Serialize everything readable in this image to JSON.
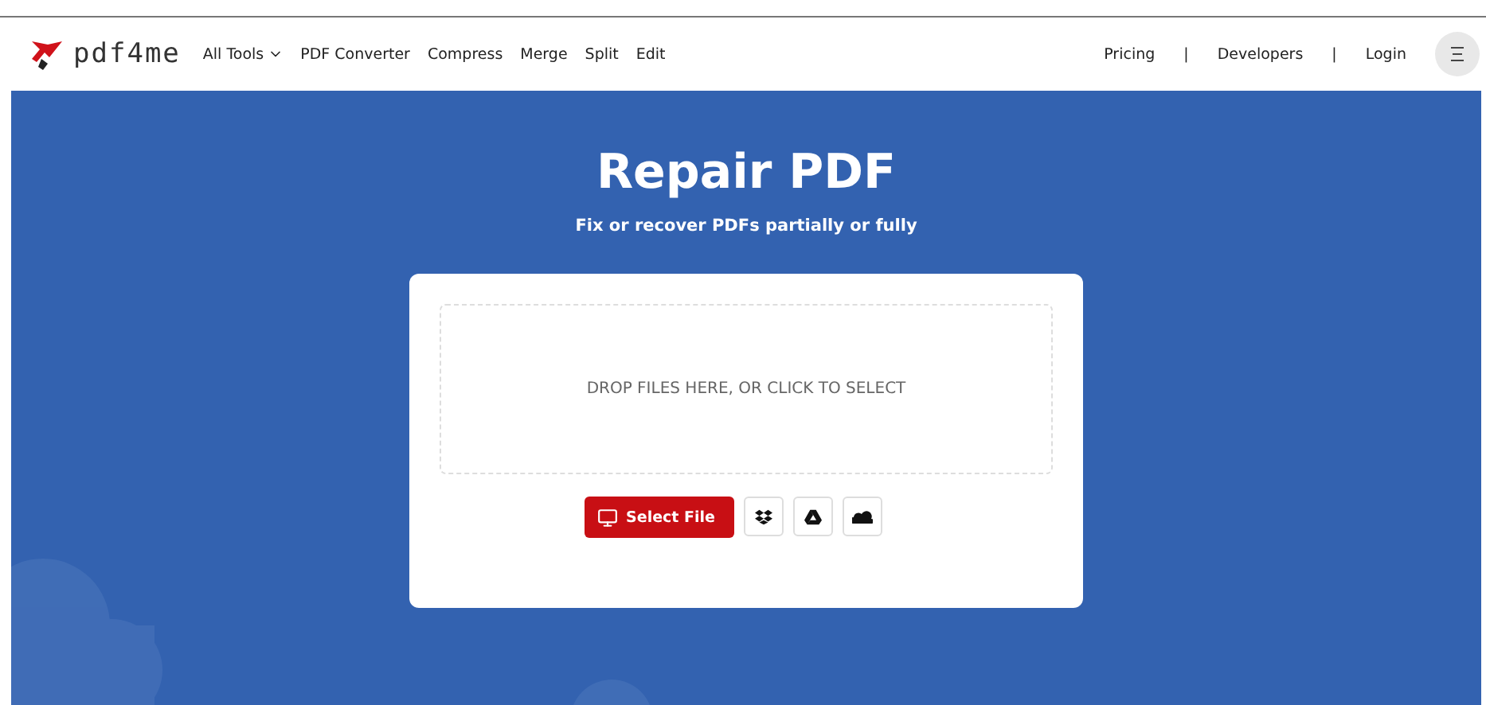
{
  "header": {
    "brand": "pdf4me",
    "nav": [
      {
        "label": "All Tools",
        "dropdown": true
      },
      {
        "label": "PDF Converter",
        "dropdown": false
      },
      {
        "label": "Compress",
        "dropdown": false
      },
      {
        "label": "Merge",
        "dropdown": false
      },
      {
        "label": "Split",
        "dropdown": false
      },
      {
        "label": "Edit",
        "dropdown": false
      }
    ],
    "right_links": [
      {
        "label": "Pricing"
      },
      {
        "label": "|"
      },
      {
        "label": "Developers"
      },
      {
        "label": "|"
      },
      {
        "label": "Login"
      }
    ]
  },
  "hero": {
    "title": "Repair PDF",
    "subtitle": "Fix or recover PDFs partially or fully"
  },
  "upload": {
    "drop_text": "DROP FILES HERE, OR CLICK TO SELECT",
    "select_button": "Select File",
    "sources": [
      {
        "kind": "dropbox"
      },
      {
        "kind": "drive"
      },
      {
        "kind": "cloud"
      }
    ]
  }
}
